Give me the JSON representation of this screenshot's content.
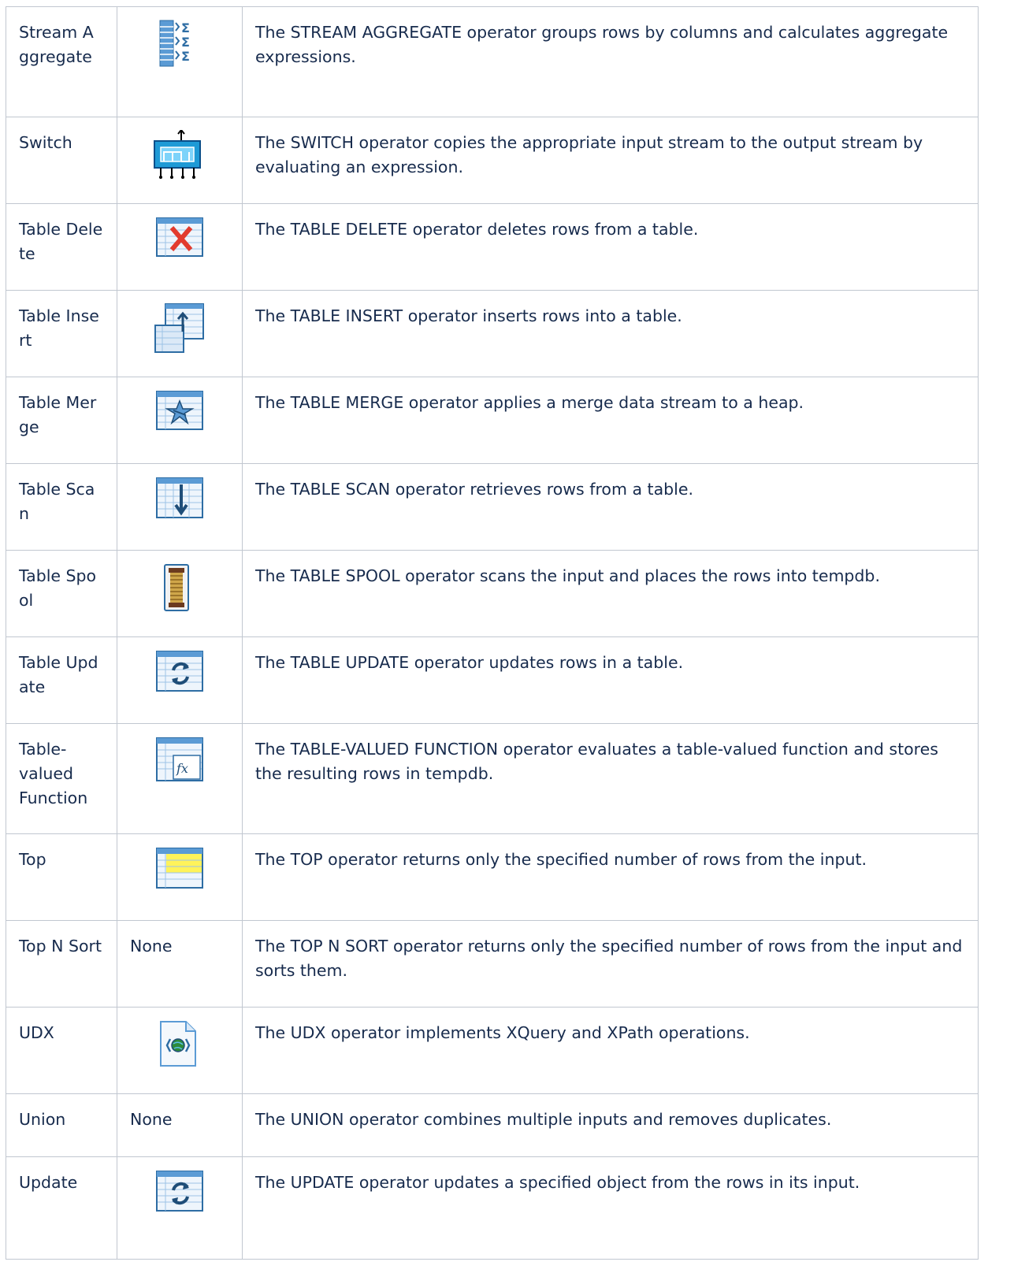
{
  "rows": [
    {
      "name": "Stream Aggregate",
      "icon": "stream-aggregate-icon",
      "description": "The STREAM AGGREGATE operator groups rows by columns and calculates aggregate expressions."
    },
    {
      "name": "Switch",
      "icon": "switch-icon",
      "description": "The SWITCH operator copies the appropriate input stream to the output stream by evaluating an expression."
    },
    {
      "name": "Table Delete",
      "icon": "table-delete-icon",
      "description": "The TABLE DELETE operator deletes rows from a table."
    },
    {
      "name": "Table Insert",
      "icon": "table-insert-icon",
      "description": "The TABLE INSERT operator inserts rows into a table."
    },
    {
      "name": "Table Merge",
      "icon": "table-merge-icon",
      "description": "The TABLE MERGE operator applies a merge data stream to a heap."
    },
    {
      "name": "Table Scan",
      "icon": "table-scan-icon",
      "description": "The TABLE SCAN operator retrieves rows from a table."
    },
    {
      "name": "Table Spool",
      "icon": "table-spool-icon",
      "description": "The TABLE SPOOL operator scans the input and places the rows into tempdb."
    },
    {
      "name": "Table Update",
      "icon": "table-update-icon",
      "description": "The TABLE UPDATE operator updates rows in a table."
    },
    {
      "name": "Table-valued Function",
      "icon": "table-valued-function-icon",
      "description": "The TABLE-VALUED FUNCTION operator evaluates a table-valued function and stores the resulting rows in tempdb."
    },
    {
      "name": "Top",
      "icon": "top-icon",
      "description": "The TOP operator returns only the specified number of rows from the input."
    },
    {
      "name": "Top N Sort",
      "icon_text": "None",
      "description": "The TOP N SORT operator returns only the specified number of rows from the input and sorts them."
    },
    {
      "name": "UDX",
      "icon": "udx-icon",
      "description": "The UDX operator implements XQuery and XPath operations."
    },
    {
      "name": "Union",
      "icon_text": "None",
      "description": "The UNION operator combines multiple inputs and removes duplicates."
    },
    {
      "name": "Update",
      "icon": "update-icon",
      "description": "The UPDATE operator updates a specified object from the rows in its input."
    }
  ]
}
